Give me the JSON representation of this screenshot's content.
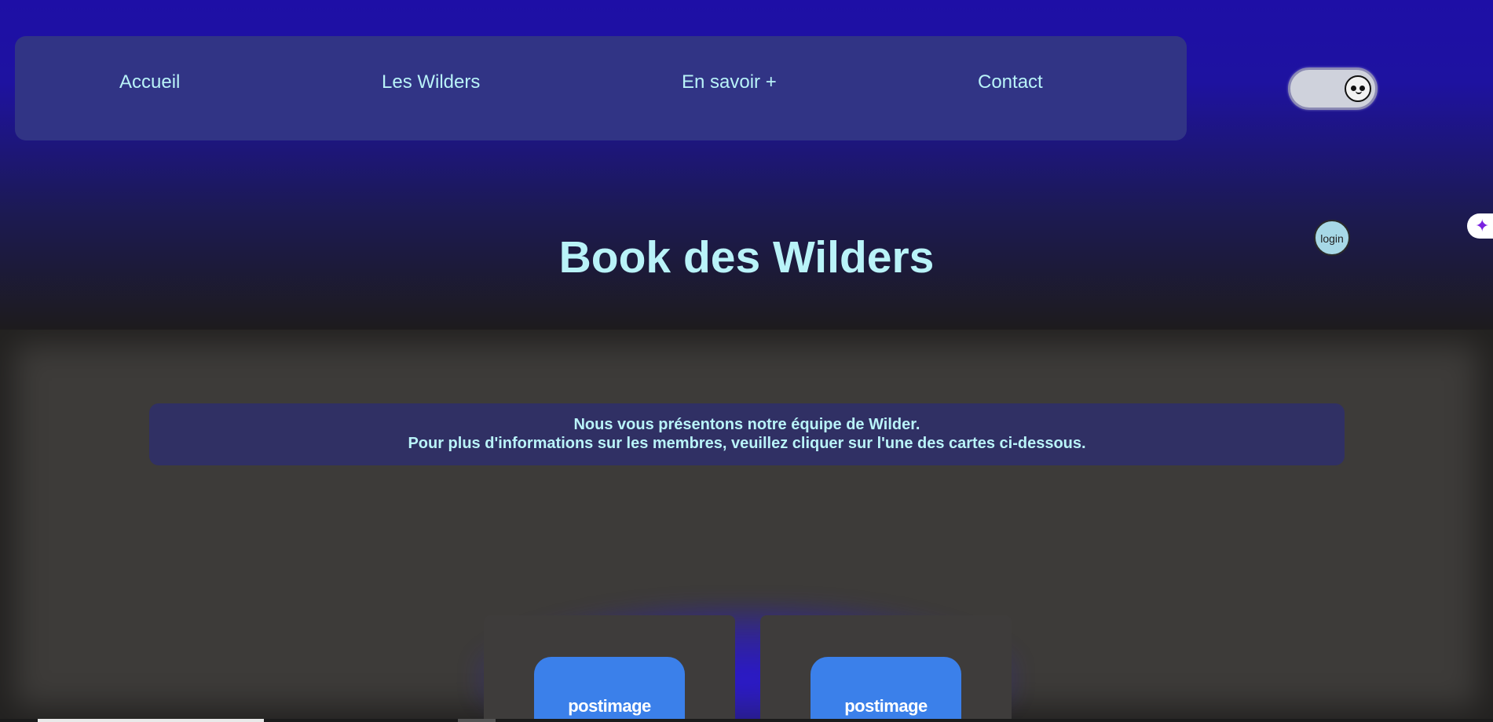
{
  "nav": {
    "items": [
      {
        "label": "Accueil"
      },
      {
        "label": "Les Wilders"
      },
      {
        "label": "En savoir +"
      },
      {
        "label": "Contact"
      }
    ]
  },
  "theme_toggle": {
    "icon": "smiley-face-icon"
  },
  "header": {
    "title": "Book des Wilders"
  },
  "login": {
    "alt": "login"
  },
  "sparkle": {
    "icon": "sparkle-icon",
    "color": "#7a22e0"
  },
  "intro": {
    "line1": "Nous vous présentons notre équipe de Wilder.",
    "line2": "Pour plus d'informations sur les membres, veuillez cliquer sur l'une des cartes ci-dessous."
  },
  "cards": [
    {
      "image_text": "postimage"
    },
    {
      "image_text": "postimage"
    }
  ],
  "colors": {
    "accent_text": "#b9f3f8",
    "header_top": "#1e0fa6",
    "navbar_bg": "#313485",
    "card_image": "#3b80ea"
  }
}
